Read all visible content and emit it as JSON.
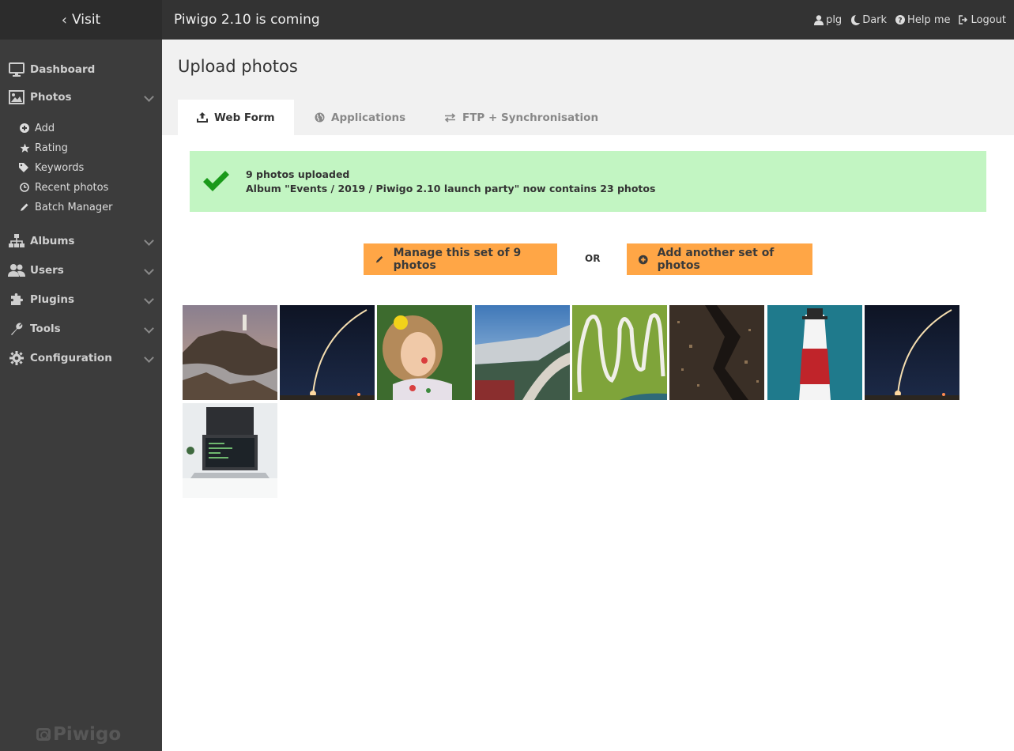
{
  "sidebar": {
    "visit_label": "Visit",
    "menu": {
      "dashboard": "Dashboard",
      "photos": "Photos",
      "albums": "Albums",
      "users": "Users",
      "plugins": "Plugins",
      "tools": "Tools",
      "configuration": "Configuration"
    },
    "photos_sub": {
      "add": "Add",
      "rating": "Rating",
      "keywords": "Keywords",
      "recent": "Recent photos",
      "batch": "Batch Manager"
    },
    "brand": "Piwigo"
  },
  "topbar": {
    "title": "Piwigo 2.10 is coming",
    "user": "plg",
    "theme": "Dark",
    "help": "Help me",
    "logout": "Logout"
  },
  "page": {
    "title": "Upload photos",
    "tabs": {
      "web_form": "Web Form",
      "applications": "Applications",
      "ftp": "FTP + Synchronisation"
    }
  },
  "success": {
    "line1": "9 photos uploaded",
    "line2": "Album \"Events / 2019 / Piwigo 2.10 launch party\" now contains 23 photos"
  },
  "actions": {
    "manage": "Manage this set of 9 photos",
    "or": "OR",
    "add_another": "Add another set of photos"
  },
  "colors": {
    "sidebar_bg": "#3c3c3c",
    "topbar_bg": "#333333",
    "accent_orange": "#ffa646",
    "success_bg": "#c2f5c2",
    "check_green": "#1a9a1a"
  }
}
